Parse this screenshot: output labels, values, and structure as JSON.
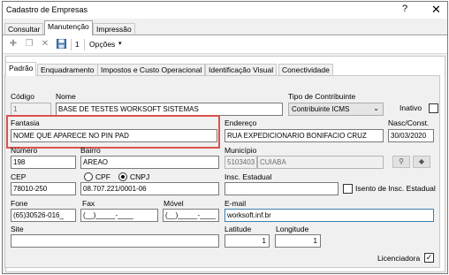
{
  "window": {
    "title": "Cadastro de Empresas",
    "help_glyph": "?",
    "close_glyph": "✕"
  },
  "top_tabs": [
    "Consultar",
    "Manutenção",
    "Impressão"
  ],
  "toolbar": {
    "count": "1",
    "options_label": "Opções"
  },
  "sub_tabs": [
    "Padrão",
    "Enquadramento",
    "Impostos e Custo Operacional",
    "Identificação Visual",
    "Conectividade"
  ],
  "form": {
    "codigo": {
      "label": "Código",
      "value": "1"
    },
    "nome": {
      "label": "Nome",
      "value": "BASE DE TESTES WORKSOFT SISTEMAS"
    },
    "tipo_contribuinte": {
      "label": "Tipo de Contribuinte",
      "value": "Contribuinte ICMS"
    },
    "inativo": {
      "label": "Inativo",
      "checked": false
    },
    "fantasia": {
      "label": "Fantasia",
      "value": "NOME QUE APARECE NO PIN PAD"
    },
    "endereco": {
      "label": "Endereço",
      "value": "RUA EXPEDICIONARIO BONIFACIO CRUZ"
    },
    "nasc_const": {
      "label": "Nasc/Const.",
      "value": "30/03/2020"
    },
    "numero": {
      "label": "Número",
      "value": "198"
    },
    "bairro": {
      "label": "Bairro",
      "value": "AREAO"
    },
    "municipio": {
      "label": "Município",
      "code": "5103403",
      "name": "CUIABA"
    },
    "cep": {
      "label": "CEP",
      "value": "78010-250"
    },
    "cpf_label": "CPF",
    "cnpj_label": "CNPJ",
    "cnpj_value": "08.707.221/0001-06",
    "insc_estadual": {
      "label": "Insc. Estadual",
      "value": ""
    },
    "isento": {
      "label": "Isento de Insc. Estadual",
      "checked": false
    },
    "fone": {
      "label": "Fone",
      "value": "(65)30526-016_"
    },
    "fax": {
      "label": "Fax",
      "value": "(__)_____-____"
    },
    "movel": {
      "label": "Móvel",
      "value": "(__)_____-____"
    },
    "email": {
      "label": "E-mail",
      "value": "worksoft.inf.br"
    },
    "site": {
      "label": "Site",
      "value": ""
    },
    "latitude": {
      "label": "Latitude",
      "value": "1"
    },
    "longitude": {
      "label": "Longitude",
      "value": "1"
    },
    "licenciadora": {
      "label": "Licenciadora",
      "checked": true
    }
  },
  "colors": {
    "highlight": "#d9534f",
    "focus_border": "#3c7fb1"
  }
}
